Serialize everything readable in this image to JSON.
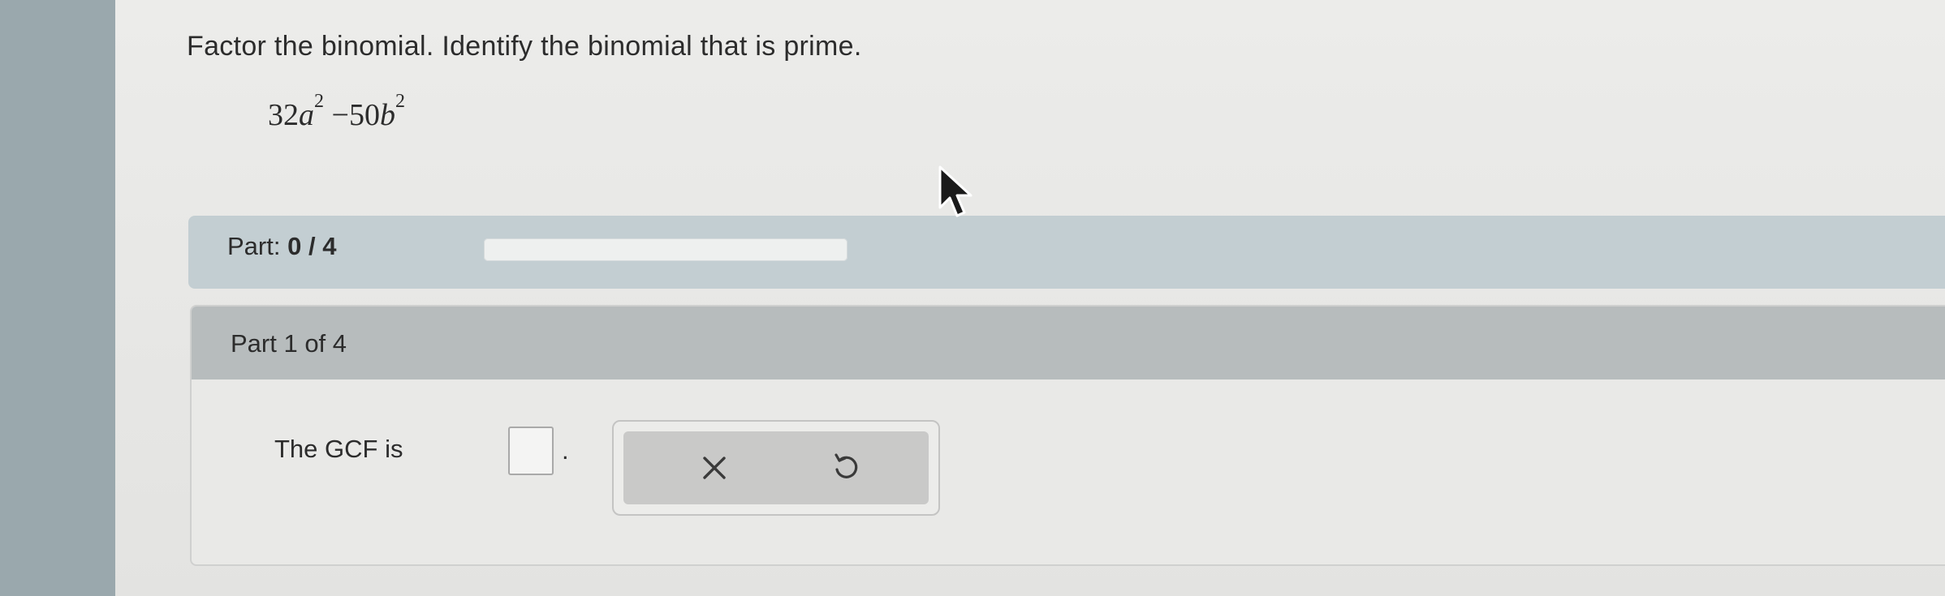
{
  "question": {
    "prompt": "Factor the binomial. Identify the binomial that is prime.",
    "expression": {
      "coef1": "32",
      "var1": "a",
      "exp1": "2",
      "operator": "−",
      "coef2": "50",
      "var2": "b",
      "exp2": "2"
    }
  },
  "progress": {
    "label": "Part:",
    "current": "0",
    "separator": "/",
    "total": "4",
    "fraction": 0,
    "accent_color": "#2e7d6e"
  },
  "part": {
    "title": "Part 1 of 4",
    "gcf_label": "The GCF is",
    "period": ".",
    "answer_value": ""
  },
  "tools": {
    "clear_icon": "x-icon",
    "undo_icon": "undo-icon"
  }
}
